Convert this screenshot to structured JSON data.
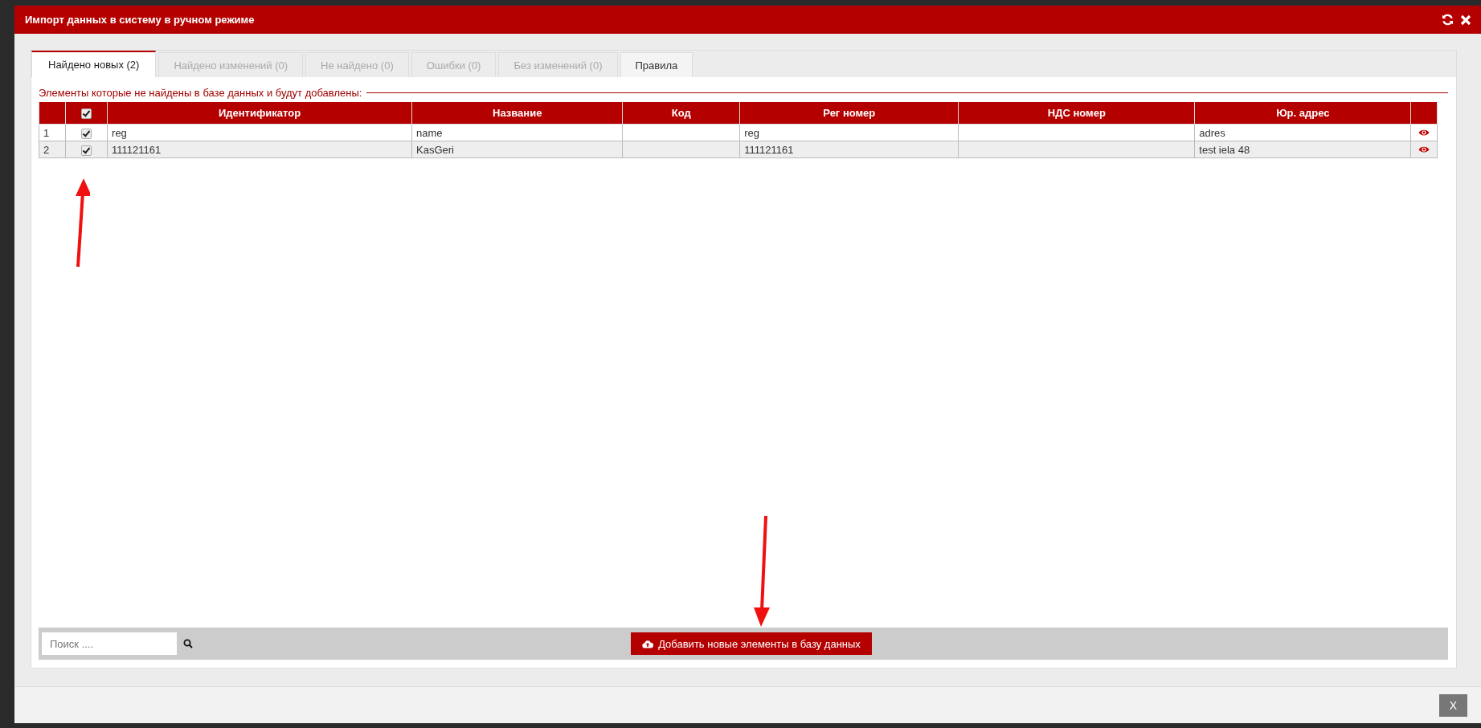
{
  "window": {
    "title": "Импорт данных в систему в ручном режиме"
  },
  "tabs": [
    {
      "label": "Найдено новых (2)",
      "selected": true,
      "disabled": false
    },
    {
      "label": "Найдено изменений (0)",
      "selected": false,
      "disabled": true
    },
    {
      "label": "Не найдено (0)",
      "selected": false,
      "disabled": true
    },
    {
      "label": "Ошибки (0)",
      "selected": false,
      "disabled": true
    },
    {
      "label": "Без изменений (0)",
      "selected": false,
      "disabled": true
    },
    {
      "label": "Правила",
      "selected": false,
      "disabled": false
    }
  ],
  "section_title": "Элементы которые не найдены в базе данных и будут добавлены:",
  "table": {
    "header_checked": true,
    "columns": [
      "Идентификатор",
      "Название",
      "Код",
      "Рег номер",
      "НДС номер",
      "Юр. адрес"
    ],
    "rows": [
      {
        "number": "1",
        "checked": true,
        "cells": [
          "reg",
          "name",
          null,
          "reg",
          null,
          "adres"
        ]
      },
      {
        "number": "2",
        "checked": true,
        "cells": [
          "111121161",
          "KasGeri",
          null,
          "111121161",
          null,
          "test iela 48"
        ]
      }
    ]
  },
  "search": {
    "placeholder": "Поиск ...."
  },
  "add_button": "Добавить новые элементы в базу данных",
  "close_button": "X"
}
